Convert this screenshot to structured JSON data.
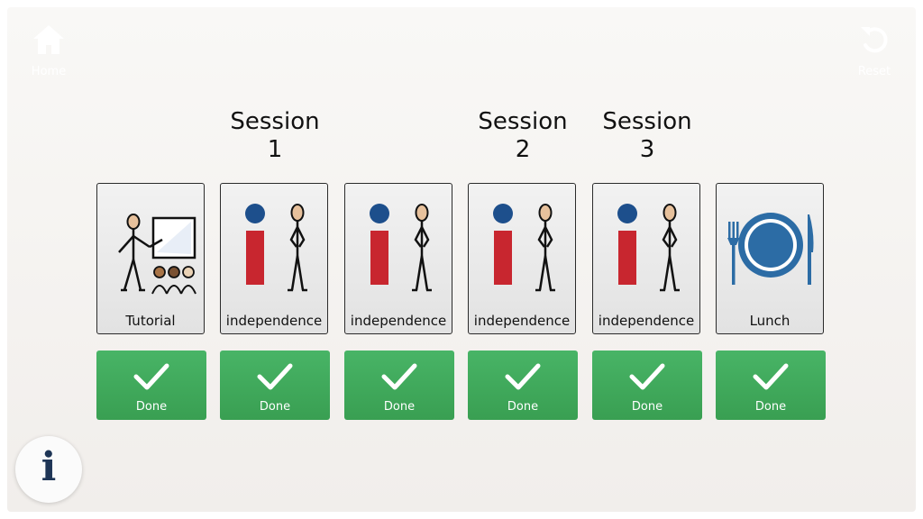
{
  "nav": {
    "home_label": "Home",
    "reset_label": "Reset",
    "home_icon": "home-icon",
    "reset_icon": "reset-icon",
    "info_icon": "info-icon"
  },
  "sessions": [
    {
      "label": "Session",
      "number": "1"
    },
    {
      "label": "Session",
      "number": "2"
    },
    {
      "label": "Session",
      "number": "3"
    }
  ],
  "schedule": [
    {
      "caption": "Tutorial",
      "icon": "tutorial-icon",
      "done_label": "Done"
    },
    {
      "caption": "independence",
      "icon": "independence-icon",
      "done_label": "Done"
    },
    {
      "caption": "independence",
      "icon": "independence-icon",
      "done_label": "Done"
    },
    {
      "caption": "independence",
      "icon": "independence-icon",
      "done_label": "Done"
    },
    {
      "caption": "independence",
      "icon": "independence-icon",
      "done_label": "Done"
    },
    {
      "caption": "Lunch",
      "icon": "lunch-icon",
      "done_label": "Done"
    }
  ],
  "info": {
    "glyph": "i"
  },
  "colors": {
    "done_green": "#43ab5e",
    "independence_red": "#c8262f",
    "independence_blue": "#1d4f8c",
    "plate_blue": "#2c6ca5",
    "icon_text_navy": "#1e3556"
  }
}
